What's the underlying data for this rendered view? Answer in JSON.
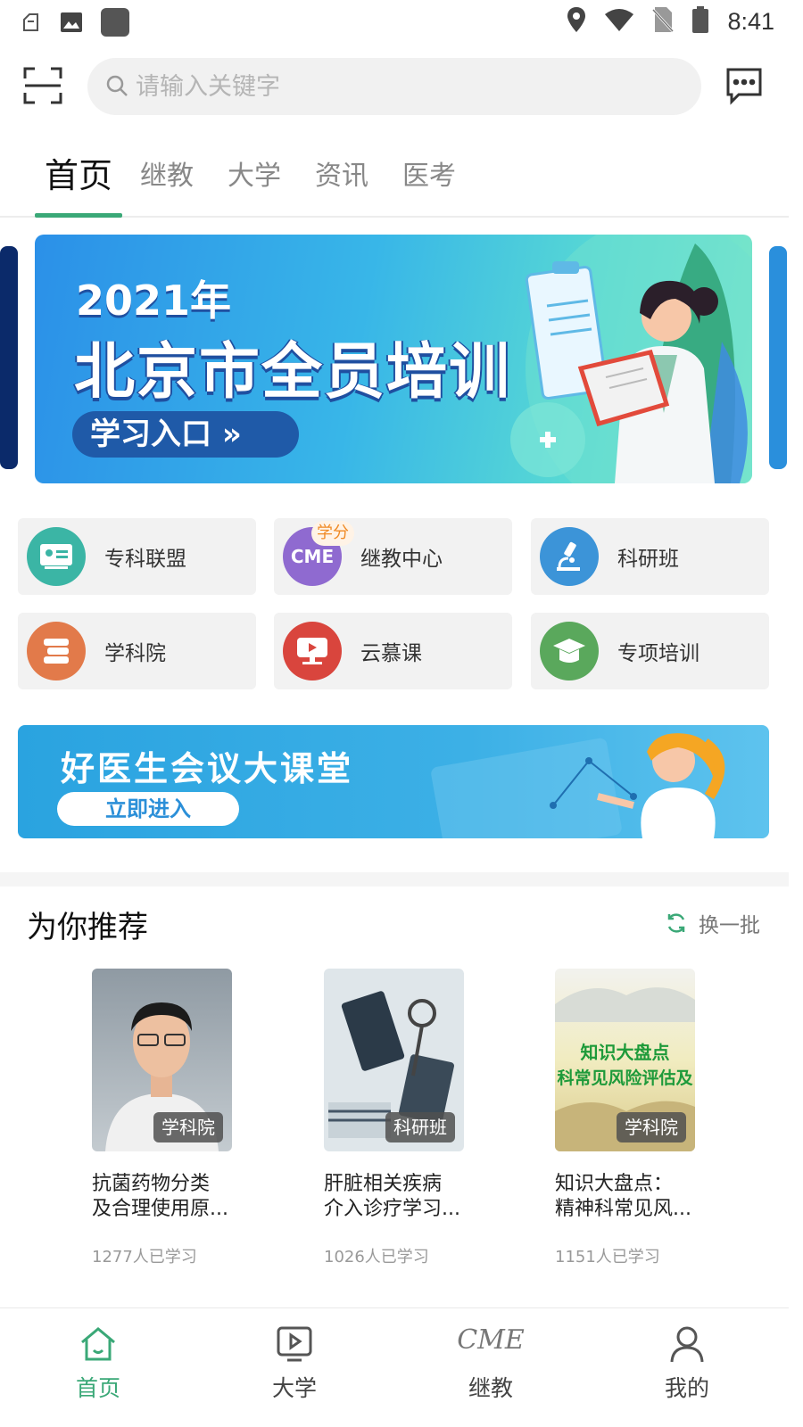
{
  "status_bar": {
    "time": "8:41",
    "left_icons": [
      "notification-icon",
      "image-icon",
      "app-icon"
    ],
    "right_icons": [
      "location-icon",
      "wifi-icon",
      "no-sim-icon",
      "battery-icon"
    ]
  },
  "topbar": {
    "search_placeholder": "请输入关键字",
    "scan_icon": "scan-icon",
    "message_icon": "message-icon"
  },
  "tabs": [
    {
      "label": "首页",
      "active": true
    },
    {
      "label": "继教",
      "active": false
    },
    {
      "label": "大学",
      "active": false
    },
    {
      "label": "资讯",
      "active": false
    },
    {
      "label": "医考",
      "active": false
    }
  ],
  "banner": {
    "year": "2021年",
    "title": "北京市全员培训",
    "button": "学习入口 »"
  },
  "quick_entries": [
    {
      "label": "专科联盟",
      "icon": "id-card-icon",
      "color": "#3bb5a5"
    },
    {
      "label": "继教中心",
      "icon": "cme-icon",
      "color": "#8f6ad0",
      "badge": "学分"
    },
    {
      "label": "科研班",
      "icon": "microscope-icon",
      "color": "#3c94d8"
    },
    {
      "label": "学科院",
      "icon": "books-icon",
      "color": "#e27a4a"
    },
    {
      "label": "云慕课",
      "icon": "play-screen-icon",
      "color": "#d9453d"
    },
    {
      "label": "专项培训",
      "icon": "graduation-cap-icon",
      "color": "#5aa85c"
    }
  ],
  "banner2": {
    "title": "好医生会议大课堂",
    "button": "立即进入"
  },
  "recommend": {
    "title": "为你推荐",
    "refresh_label": "换一批",
    "items": [
      {
        "tag": "学科院",
        "title_line1": "抗菌药物分类",
        "title_line2": "及合理使用原...",
        "count": "1277人已学习"
      },
      {
        "tag": "科研班",
        "title_line1": "肝脏相关疾病",
        "title_line2": "介入诊疗学习...",
        "count": "1026人已学习"
      },
      {
        "tag": "学科院",
        "title_line1": "知识大盘点：",
        "title_line2": "精神科常见风...",
        "count": "1151人已学习",
        "thumb_text_1": "知识大盘点",
        "thumb_text_2": "科常见风险评估及"
      }
    ]
  },
  "bottom_nav": [
    {
      "label": "首页",
      "icon": "home-icon",
      "active": true
    },
    {
      "label": "大学",
      "icon": "video-play-icon",
      "active": false
    },
    {
      "label": "继教",
      "icon": "cme-text-icon",
      "active": false,
      "icon_text": "CME"
    },
    {
      "label": "我的",
      "icon": "user-icon",
      "active": false
    }
  ],
  "colors": {
    "accent": "#3aa877",
    "banner_blue": "#2b90e8",
    "badge_orange": "#f08a24"
  }
}
